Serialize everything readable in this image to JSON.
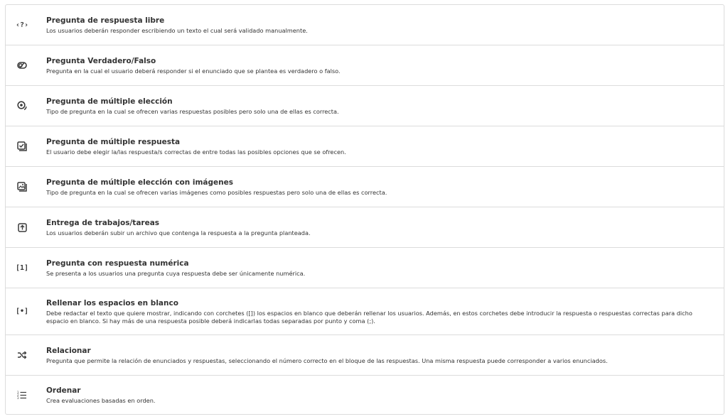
{
  "question_types": [
    {
      "icon": "code-question-icon",
      "title": "Pregunta de respuesta libre",
      "description": "Los usuarios deberán responder escribiendo un texto el cual será validado manualmente."
    },
    {
      "icon": "true-false-icon",
      "title": "Pregunta Verdadero/Falso",
      "description": "Pregunta en la cual el usuario deberá responder si el enunciado que se plantea es verdadero o falso."
    },
    {
      "icon": "radio-target-icon",
      "title": "Pregunta de múltiple elección",
      "description": "Tipo de pregunta en la cual se ofrecen varias respuestas posibles pero solo una de ellas es correcta."
    },
    {
      "icon": "checkbox-multiple-icon",
      "title": "Pregunta de múltiple respuesta",
      "description": "El usuario debe elegir la/las respuesta/s correctas de entre todas las posibles opciones que se ofrecen."
    },
    {
      "icon": "image-multiple-icon",
      "title": "Pregunta de múltiple elección con imágenes",
      "description": "Tipo de pregunta en la cual se ofrecen varias imágenes como posibles respuestas pero solo una de ellas es correcta."
    },
    {
      "icon": "upload-icon",
      "title": "Entrega de trabajos/tareas",
      "description": "Los usuarios deberán subir un archivo que contenga la respuesta a la pregunta planteada."
    },
    {
      "icon": "numeric-brackets-icon",
      "title": "Pregunta con respuesta numérica",
      "description": "Se presenta a los usuarios una pregunta cuya respuesta debe ser únicamente numérica."
    },
    {
      "icon": "blank-brackets-icon",
      "title": "Rellenar los espacios en blanco",
      "description": "Debe redactar el texto que quiere mostrar, indicando con corchetes ([]) los espacios en blanco que deberán rellenar los usuarios. Además, en estos corchetes debe introducir la respuesta o respuestas correctas para dicho espacio en blanco. Si hay más de una respuesta posible deberá indicarlas todas separadas por punto y coma (;)."
    },
    {
      "icon": "shuffle-icon",
      "title": "Relacionar",
      "description": "Pregunta que permite la relación de enunciados y respuestas, seleccionando el número correcto en el bloque de las respuestas. Una misma respuesta puede corresponder a varios enunciados."
    },
    {
      "icon": "ordered-list-icon",
      "title": "Ordenar",
      "description": "Crea evaluaciones basadas en orden."
    }
  ]
}
